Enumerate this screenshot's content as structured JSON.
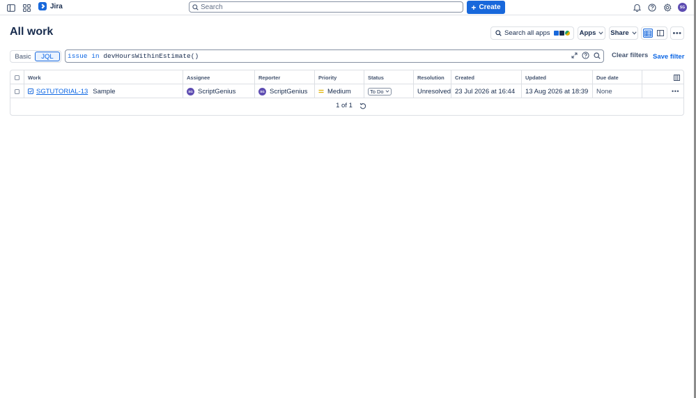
{
  "topnav": {
    "app_name": "Jira",
    "search_placeholder": "Search",
    "create_label": "Create",
    "avatar_initials": "SG",
    "brand_color": "#1868db"
  },
  "header": {
    "title": "All work",
    "search_apps_label": "Search all apps",
    "apps_label": "Apps",
    "share_label": "Share"
  },
  "jql": {
    "mode_basic": "Basic",
    "mode_jql": "JQL",
    "query_field": "issue",
    "query_operator": "in",
    "query_function": "devHoursWithinEstimate()",
    "clear_filters": "Clear filters",
    "save_filter": "Save filter"
  },
  "table": {
    "columns": [
      "Work",
      "Assignee",
      "Reporter",
      "Priority",
      "Status",
      "Resolution",
      "Created",
      "Updated",
      "Due date"
    ],
    "rows": [
      {
        "key": "SGTUTORIAL-13",
        "summary": "Sample",
        "assignee": "ScriptGenius",
        "assignee_initials": "SG",
        "reporter": "ScriptGenius",
        "reporter_initials": "SG",
        "priority": "Medium",
        "status": "To Do",
        "resolution": "Unresolved",
        "created": "23 Jul 2026 at 16:44",
        "updated": "13 Aug 2026 at 18:39",
        "due_date": "None"
      }
    ],
    "pagination": "1 of 1"
  }
}
